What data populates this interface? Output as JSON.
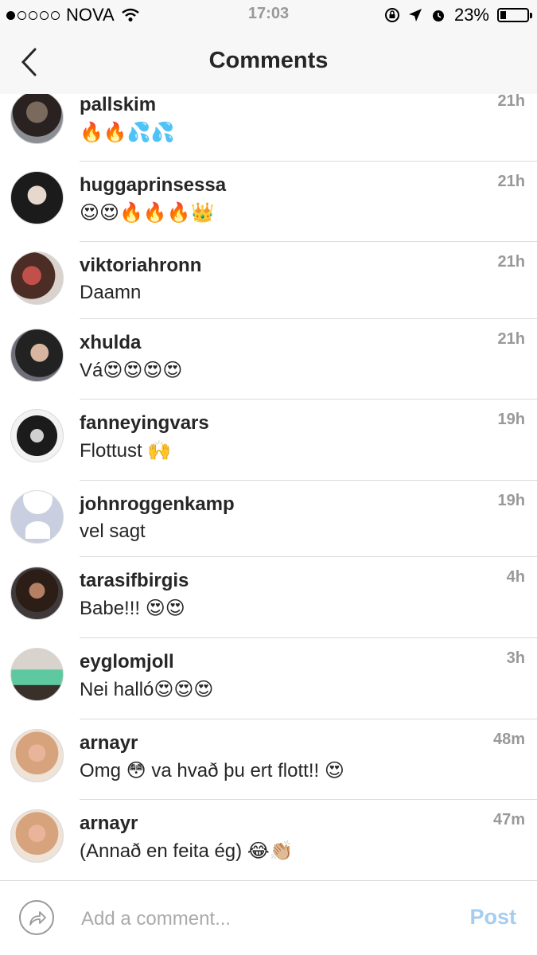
{
  "status_bar": {
    "carrier": "NOVA",
    "time": "17:03",
    "battery": "23%",
    "battery_fraction": 0.23
  },
  "header": {
    "title": "Comments"
  },
  "comments": [
    {
      "username": "pallskim",
      "text": "🔥🔥💦💦",
      "time": "21h"
    },
    {
      "username": "huggaprinsessa",
      "text": "😍😍🔥🔥🔥👑",
      "time": "21h"
    },
    {
      "username": "viktoriahronn",
      "text": "Daamn",
      "time": "21h"
    },
    {
      "username": "xhulda",
      "text": "Vá😍😍😍😍",
      "time": "21h"
    },
    {
      "username": "fanneyingvars",
      "text": "Flottust 🙌",
      "time": "19h"
    },
    {
      "username": "johnroggenkamp",
      "text": "vel sagt",
      "time": "19h"
    },
    {
      "username": "tarasifbirgis",
      "text": "Babe!!! 😍😍",
      "time": "4h"
    },
    {
      "username": "eyglomjoll",
      "text": "Nei halló😍😍😍",
      "time": "3h"
    },
    {
      "username": "arnayr",
      "text": "Omg 😳 va hvað þu ert flott!! 😍",
      "time": "48m"
    },
    {
      "username": "arnayr",
      "text": "(Annað en feita ég) 😂👏🏼",
      "time": "47m"
    }
  ],
  "composer": {
    "placeholder": "Add a comment...",
    "post_label": "Post"
  }
}
